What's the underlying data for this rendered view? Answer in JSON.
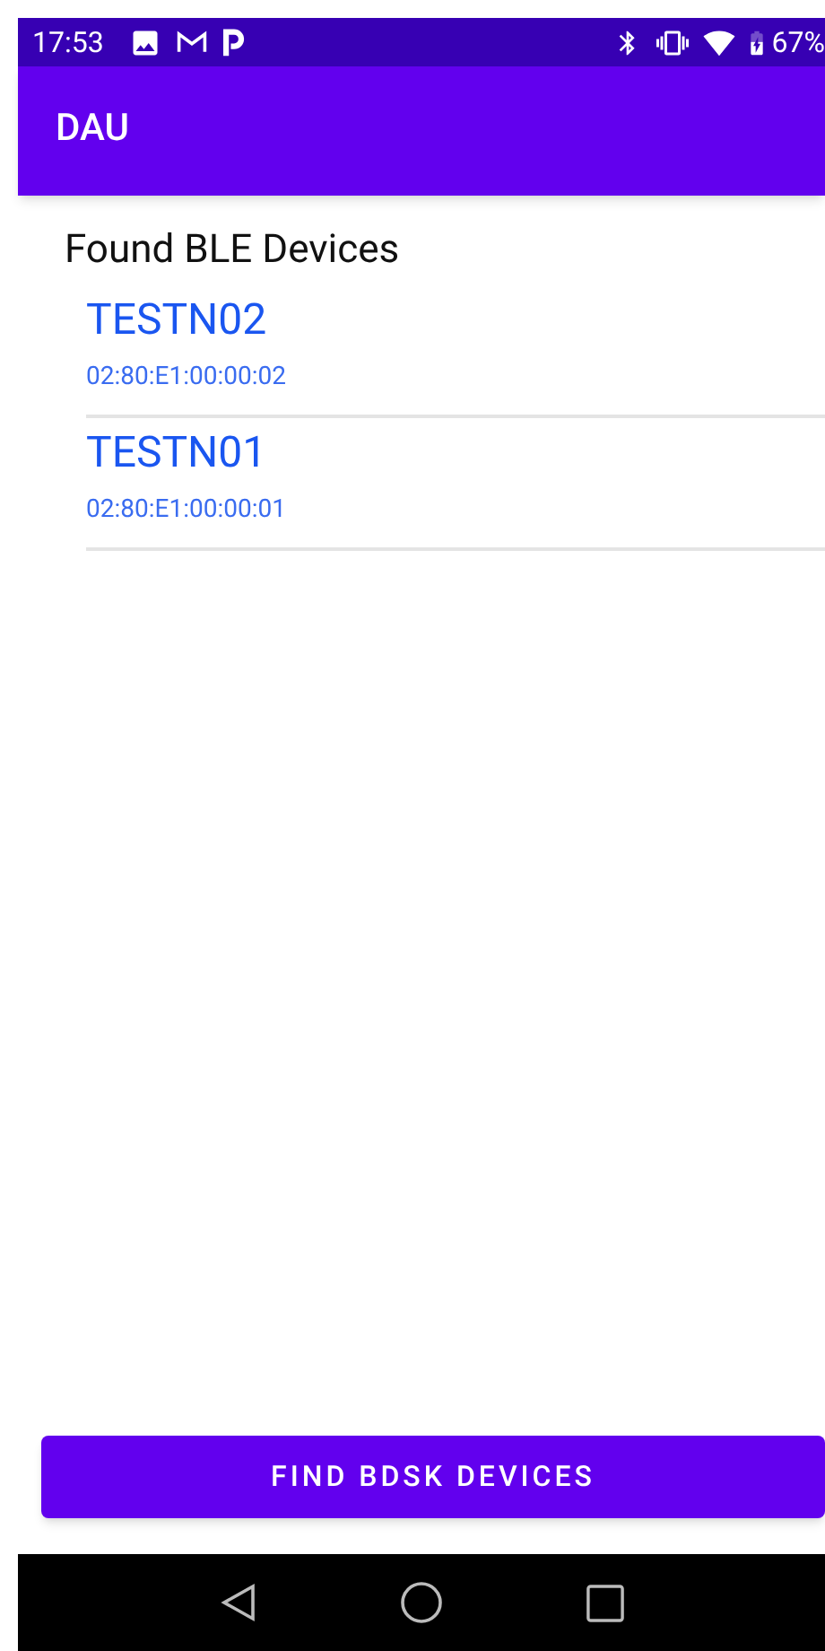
{
  "status_bar": {
    "time": "17:53",
    "battery": "67%"
  },
  "app_bar": {
    "title": "DAU"
  },
  "section_title": "Found BLE Devices",
  "devices": [
    {
      "name": "TESTN02",
      "address": "02:80:E1:00:00:02"
    },
    {
      "name": "TESTN01",
      "address": "02:80:E1:00:00:01"
    }
  ],
  "action_button": "FIND BDSK DEVICES"
}
